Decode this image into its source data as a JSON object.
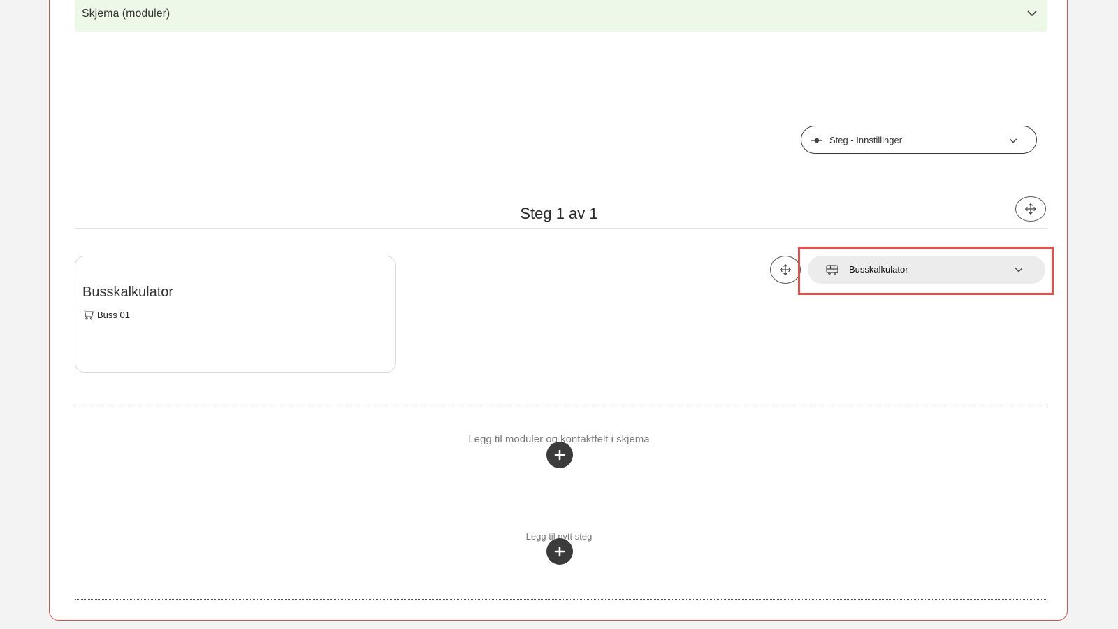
{
  "form_section": {
    "title": "Skjema (moduler)",
    "chevron_icon": "chevron-down-icon"
  },
  "step_settings": {
    "label": "Steg - Innstillinger",
    "icon": "step-commit-icon",
    "chevron_icon": "chevron-down-icon"
  },
  "step": {
    "title": "Steg 1 av 1",
    "move_icon": "move-arrows-icon"
  },
  "module_card": {
    "name": "Busskalkulator",
    "items": [
      {
        "icon": "cart-icon",
        "label": "Buss 01"
      }
    ]
  },
  "module_select": {
    "label": "Busskalkulator",
    "icon": "bus-icon",
    "chevron_icon": "chevron-down-icon",
    "move_icon": "move-arrows-icon"
  },
  "add_modules": {
    "label": "Legg til moduler og kontaktfelt i skjema",
    "icon": "plus-icon"
  },
  "add_step": {
    "label": "Legg til nytt steg",
    "icon": "plus-icon"
  },
  "colors": {
    "frame_border": "#e24b4b",
    "header_bg": "#eef8e8",
    "highlight": "#e5504c",
    "dark_button": "#3b3b3b",
    "select_bg": "#ececec"
  }
}
